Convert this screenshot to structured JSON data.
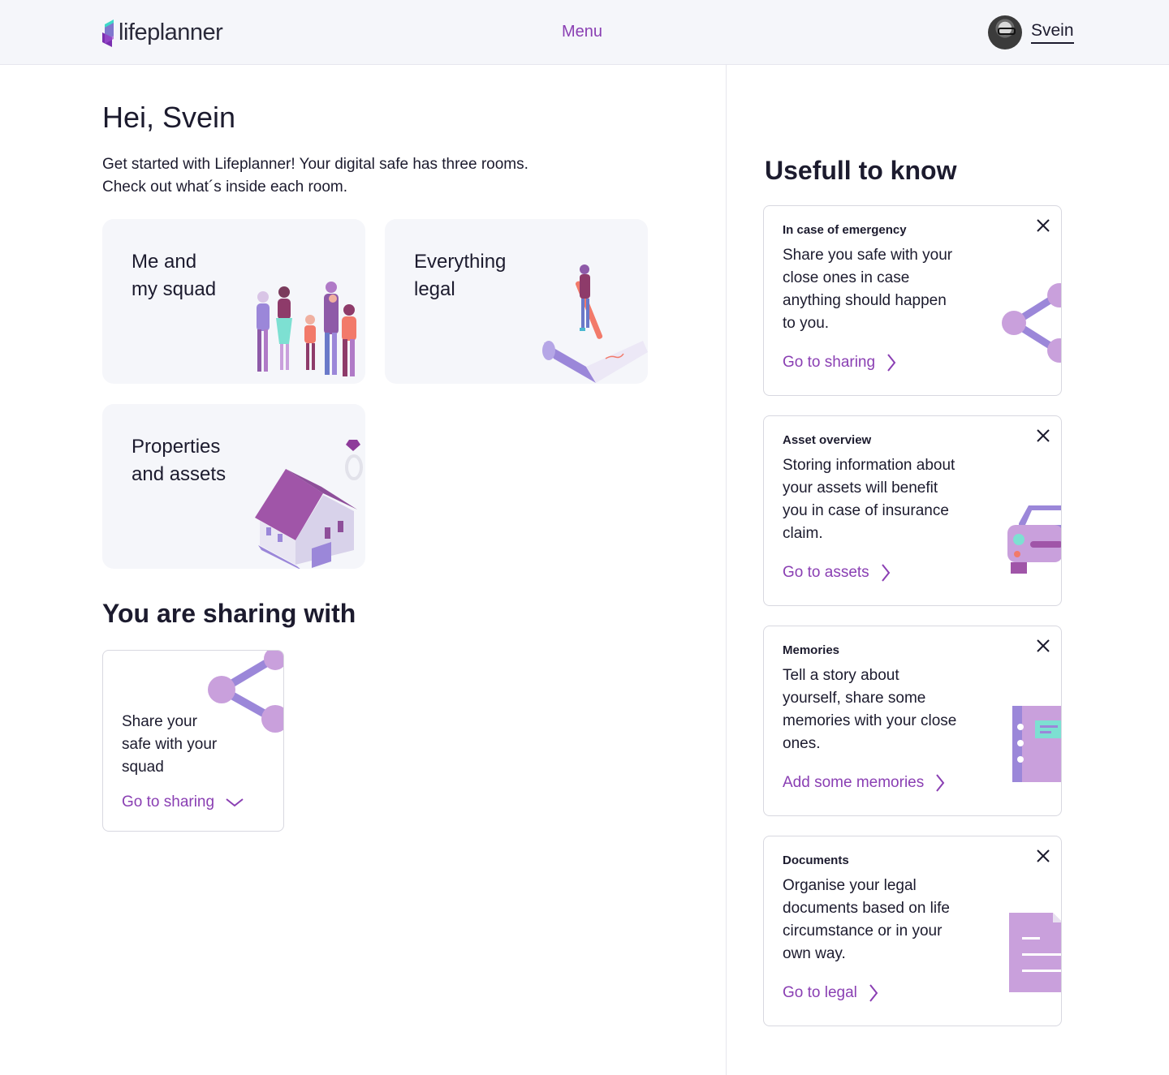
{
  "header": {
    "logo_text": "lifeplanner",
    "menu_label": "Menu",
    "user_name": "Svein"
  },
  "main": {
    "greeting": "Hei, Svein",
    "intro_line1": "Get started with Lifeplanner! Your digital safe has three rooms.",
    "intro_line2": "Check out what´s inside each room.",
    "rooms": [
      {
        "title_line1": "Me and",
        "title_line2": "my squad",
        "icon": "family-illustration"
      },
      {
        "title_line1": "Everything",
        "title_line2": "legal",
        "icon": "pen-and-document-illustration"
      },
      {
        "title_line1": "Properties",
        "title_line2": "and assets",
        "icon": "house-and-ring-illustration"
      }
    ],
    "sharing_title": "You are sharing with",
    "share_card": {
      "text_line1": "Share your",
      "text_line2": "safe with your",
      "text_line3": "squad",
      "link": "Go to sharing",
      "link_icon": "chevron-down-icon"
    }
  },
  "sidebar": {
    "title": "Usefull to know",
    "tips": [
      {
        "heading": "In case of emergency",
        "body": "Share you safe with your close ones in case anything should happen to you.",
        "link": "Go to sharing",
        "icon": "share-icon"
      },
      {
        "heading": "Asset overview",
        "body": "Storing information about your assets will benefit you in case of insurance claim.",
        "link": "Go to assets",
        "icon": "car-illustration"
      },
      {
        "heading": "Memories",
        "body": "Tell a story about yourself, share some memories with your close ones.",
        "link": "Add some memories",
        "icon": "notebook-illustration"
      },
      {
        "heading": "Documents",
        "body": "Organise your legal documents based on life circumstance or in your own way.",
        "link": "Go to legal",
        "icon": "document-illustration"
      }
    ]
  },
  "colors": {
    "accent": "#8a3fb3",
    "header_bg": "#f5f6fa",
    "card_bg": "#f5f6fa",
    "illustration_light": "#c9a0dc",
    "illustration_mid": "#9b87d9",
    "illustration_dark": "#8e5aa8"
  }
}
